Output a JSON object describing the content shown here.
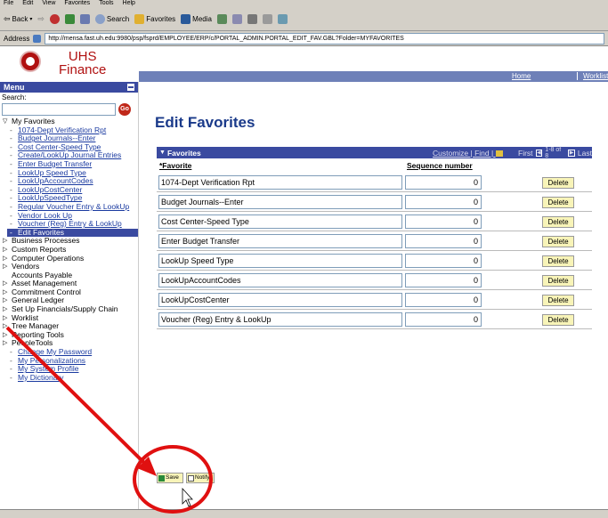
{
  "browser": {
    "menu": [
      "File",
      "Edit",
      "View",
      "Favorites",
      "Tools",
      "Help"
    ],
    "toolbar": {
      "back": "Back",
      "search": "Search",
      "favorites": "Favorites",
      "media": "Media"
    },
    "address_label": "Address",
    "address_url": "http://mensa.fast.uh.edu:9980/psp/fsprd/EMPLOYEE/ERP/c/PORTAL_ADMIN.PORTAL_EDIT_FAV.GBL?Folder=MYFAVORITES"
  },
  "header": {
    "logo_line1": "UHS",
    "logo_line2": "Finance",
    "links": [
      "Home",
      "Worklist"
    ]
  },
  "menu": {
    "title": "Menu",
    "search_label": "Search:",
    "go_label": "Go",
    "my_favorites": "My Favorites",
    "favorites_items": [
      "1074-Dept Verification Rpt",
      "Budget Journals--Enter",
      "Cost Center-Speed Type",
      "Create/LookUp Journal Entries",
      "Enter Budget Transfer",
      "LookUp Speed Type",
      "LookUpAccountCodes",
      "LookUpCostCenter",
      "LookUpSpeedType",
      "Regular Voucher Entry & LookUp",
      "Vendor Look Up",
      "Voucher (Reg) Entry & LookUp"
    ],
    "active_item": "Edit Favorites",
    "folders": [
      "Business Processes",
      "Custom Reports",
      "Computer Operations",
      "Vendors"
    ],
    "plain_item": "Accounts Payable",
    "folders2": [
      "Asset Management",
      "Commitment Control",
      "General Ledger",
      "Set Up Financials/Supply Chain",
      "Worklist",
      "Tree Manager",
      "Reporting Tools",
      "PeopleTools"
    ],
    "bottom_links": [
      "Change My Password",
      "My Personalizations",
      "My System Profile",
      "My Dictionary"
    ]
  },
  "main": {
    "title": "Edit Favorites",
    "grid_title": "Favorites",
    "customize": "Customize | Find |",
    "nav_first": "First",
    "nav_range": "1-8 of 8",
    "nav_last": "Last",
    "col_favorite": "*Favorite",
    "col_sequence": "Sequence number",
    "delete_label": "Delete",
    "rows": [
      {
        "favorite": "1074-Dept Verification Rpt",
        "sequence": "0"
      },
      {
        "favorite": "Budget Journals--Enter",
        "sequence": "0"
      },
      {
        "favorite": "Cost Center-Speed Type",
        "sequence": "0"
      },
      {
        "favorite": "Enter Budget Transfer",
        "sequence": "0"
      },
      {
        "favorite": "LookUp Speed Type",
        "sequence": "0"
      },
      {
        "favorite": "LookUpAccountCodes",
        "sequence": "0"
      },
      {
        "favorite": "LookUpCostCenter",
        "sequence": "0"
      },
      {
        "favorite": "Voucher (Reg) Entry & LookUp",
        "sequence": "0"
      }
    ],
    "save_label": "Save",
    "notify_label": "Notify"
  },
  "colors": {
    "accent": "#3a4aa0",
    "brand": "#b01010",
    "annotation": "#e01010"
  }
}
